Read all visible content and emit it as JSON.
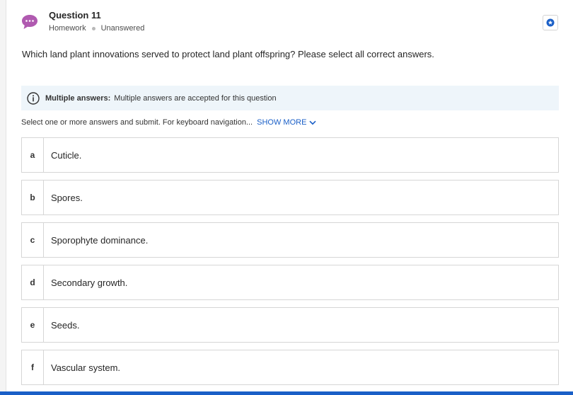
{
  "question": {
    "title": "Question 11",
    "type": "Homework",
    "status": "Unanswered",
    "prompt": "Which land plant innovations served to protect land plant offspring? Please select all correct answers.",
    "icon": "chat-bubble-icon"
  },
  "info": {
    "label": "Multiple answers:",
    "text": "Multiple answers are accepted for this question"
  },
  "instructions": {
    "text": "Select one or more answers and submit. For keyboard navigation...",
    "show_more": "SHOW MORE"
  },
  "options": [
    {
      "letter": "a",
      "text": "Cuticle."
    },
    {
      "letter": "b",
      "text": "Spores."
    },
    {
      "letter": "c",
      "text": "Sporophyte dominance."
    },
    {
      "letter": "d",
      "text": "Secondary growth."
    },
    {
      "letter": "e",
      "text": "Seeds."
    },
    {
      "letter": "f",
      "text": "Vascular system."
    }
  ],
  "colors": {
    "accent": "#1a5fc7",
    "question_icon": "#b05ab0",
    "info_bg": "#eef5fa"
  }
}
